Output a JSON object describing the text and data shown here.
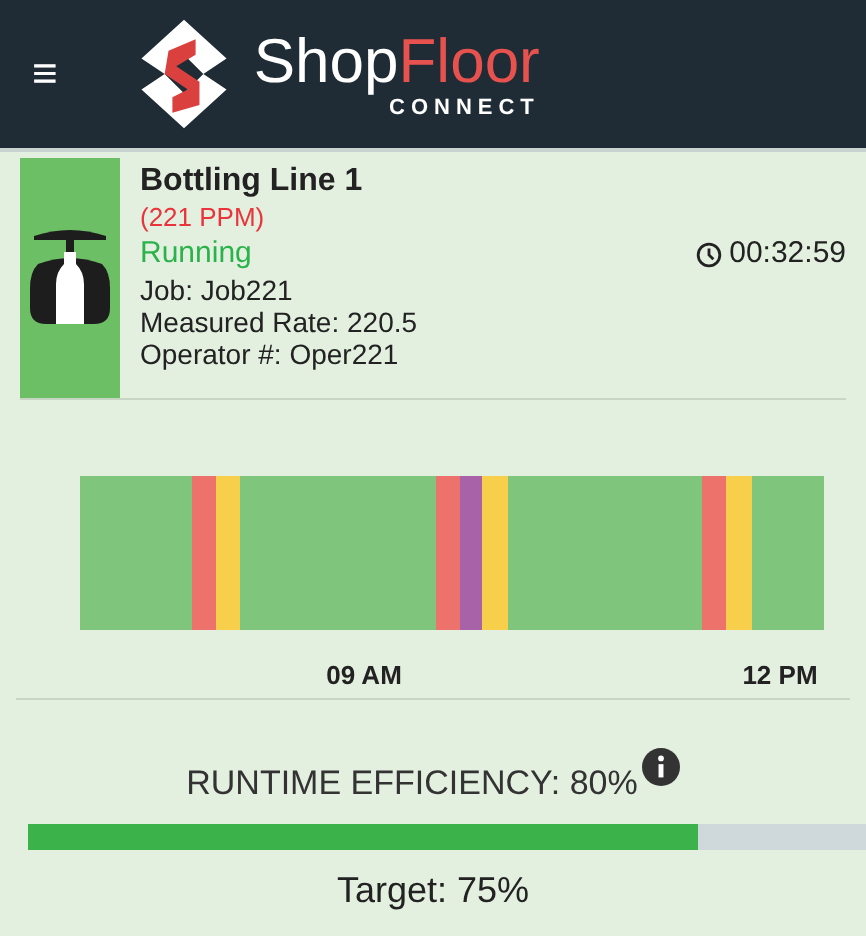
{
  "header": {
    "menu_icon": "≡",
    "logo": {
      "word_first": "Shop",
      "word_second": "Floor",
      "tagline": "CONNECT"
    }
  },
  "machine": {
    "name": "Bottling Line 1",
    "rate": "(221 PPM)",
    "status": "Running",
    "timer": "00:32:59",
    "details": [
      "Job: Job221",
      "Measured Rate: 220.5",
      "Operator #: Oper221"
    ]
  },
  "timeline": {
    "axis_labels": [
      "09 AM",
      "12 PM"
    ]
  },
  "efficiency": {
    "label": "RUNTIME EFFICIENCY: 80%",
    "level": 0.8,
    "target": "Target: 75%"
  }
}
